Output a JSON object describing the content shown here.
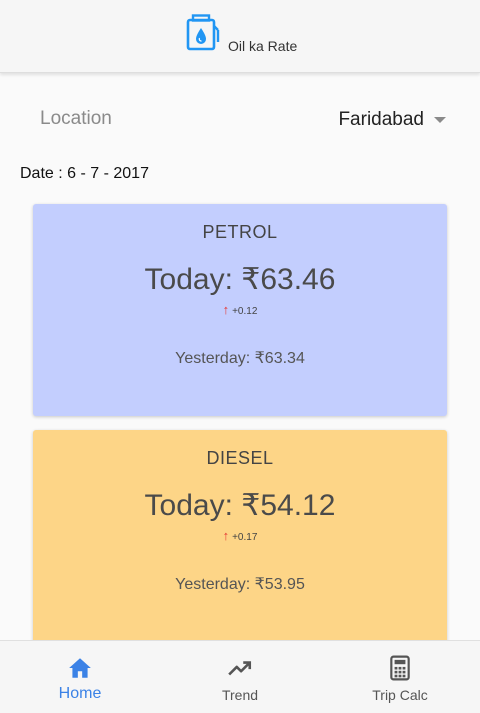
{
  "header": {
    "title": "Oil ka Rate",
    "logo_icon": "fuel-pump-icon",
    "accent_color": "#2196f3"
  },
  "location": {
    "label": "Location",
    "selected": "Faridabad"
  },
  "date_text": "Date : 6 - 7 - 2017",
  "cards": [
    {
      "name": "PETROL",
      "today": "Today: ₹63.46",
      "change": "+0.12",
      "change_direction": "up",
      "yesterday": "Yesterday: ₹63.34",
      "color": "#c3cefe"
    },
    {
      "name": "DIESEL",
      "today": "Today: ₹54.12",
      "change": "+0.17",
      "change_direction": "up",
      "yesterday": "Yesterday: ₹53.95",
      "color": "#fdd587"
    }
  ],
  "nav": {
    "items": [
      {
        "label": "Home",
        "icon": "home-icon",
        "active": true
      },
      {
        "label": "Trend",
        "icon": "trend-icon",
        "active": false
      },
      {
        "label": "Trip Calc",
        "icon": "calculator-icon",
        "active": false
      }
    ],
    "active_color": "#3b82e6"
  }
}
